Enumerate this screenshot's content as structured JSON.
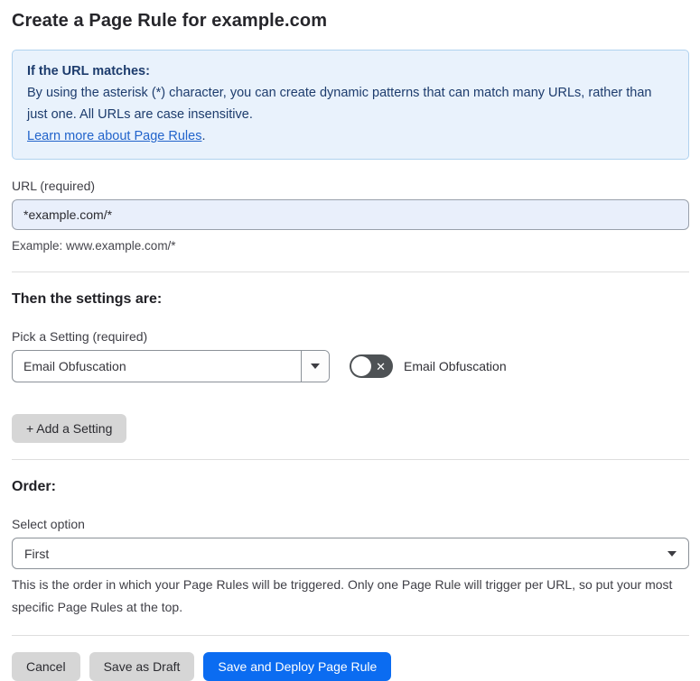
{
  "page": {
    "title": "Create a Page Rule for example.com"
  },
  "info_box": {
    "heading": "If the URL matches:",
    "body": "By using the asterisk (*) character, you can create dynamic patterns that can match many URLs, rather than just one. All URLs are case insensitive.",
    "link": "Learn more about Page Rules",
    "link_suffix": "."
  },
  "url_field": {
    "label": "URL (required)",
    "value": "*example.com/*",
    "helper": "Example: www.example.com/*"
  },
  "settings_section": {
    "heading": "Then the settings are:",
    "picker_label": "Pick a Setting (required)",
    "picker_value": "Email Obfuscation",
    "toggle_label": "Email Obfuscation",
    "toggle_state": "off",
    "toggle_x_glyph": "✕",
    "add_button": "+ Add a Setting"
  },
  "order_section": {
    "heading": "Order:",
    "select_label": "Select option",
    "select_value": "First",
    "helper": "This is the order in which your Page Rules will be triggered. Only one Page Rule will trigger per URL, so put your most specific Page Rules at the top."
  },
  "footer": {
    "cancel": "Cancel",
    "save_draft": "Save as Draft",
    "save_deploy": "Save and Deploy Page Rule"
  },
  "colors": {
    "primary_blue": "#0b6cf1",
    "info_bg": "#e9f2fc",
    "info_border": "#b0d2ef",
    "info_text": "#1d3c6d",
    "link_blue": "#2264cb",
    "input_bg": "#e9effb",
    "toggle_bg": "#4e5255",
    "button_gray": "#d6d6d6"
  }
}
